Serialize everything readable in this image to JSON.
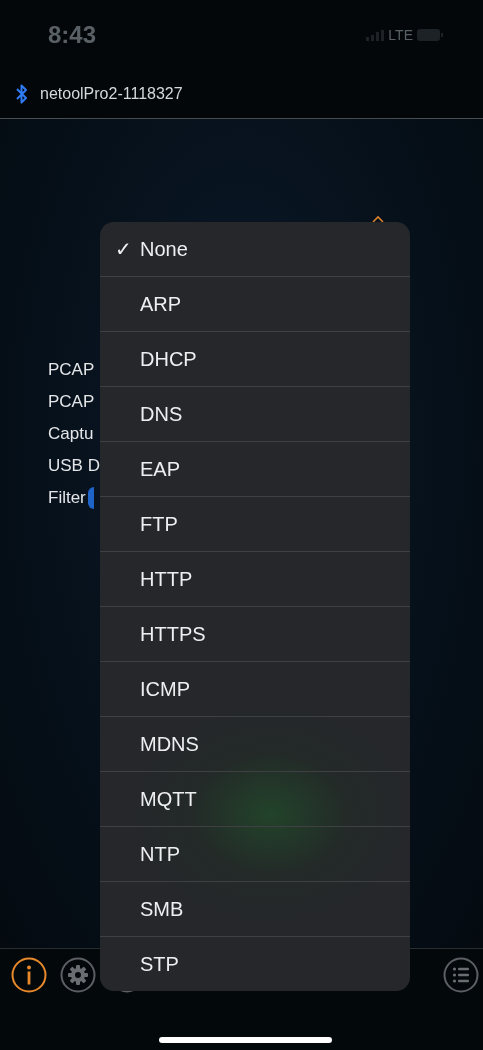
{
  "status_bar": {
    "time": "8:43",
    "network": "LTE"
  },
  "header": {
    "device": "netoolPro2-1118327"
  },
  "settings_labels": [
    "PCAP",
    "PCAP",
    "Captu",
    "USB D",
    "Filter"
  ],
  "filter_menu": {
    "items": [
      {
        "label": "None",
        "selected": true
      },
      {
        "label": "ARP",
        "selected": false
      },
      {
        "label": "DHCP",
        "selected": false
      },
      {
        "label": "DNS",
        "selected": false
      },
      {
        "label": "EAP",
        "selected": false
      },
      {
        "label": "FTP",
        "selected": false
      },
      {
        "label": "HTTP",
        "selected": false
      },
      {
        "label": "HTTPS",
        "selected": false
      },
      {
        "label": "ICMP",
        "selected": false
      },
      {
        "label": "MDNS",
        "selected": false
      },
      {
        "label": "MQTT",
        "selected": false
      },
      {
        "label": "NTP",
        "selected": false
      },
      {
        "label": "SMB",
        "selected": false
      },
      {
        "label": "STP",
        "selected": false
      }
    ]
  },
  "check_mark": "✓"
}
